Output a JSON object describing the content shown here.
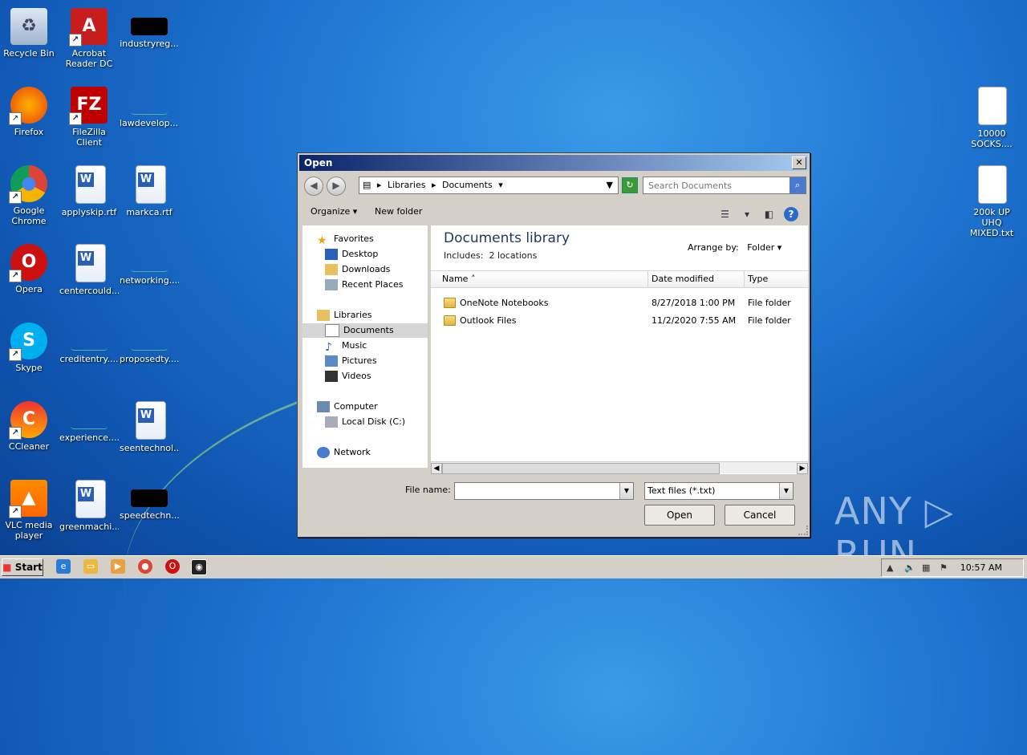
{
  "desktop": {
    "icons_left": [
      {
        "label": "Recycle Bin",
        "icon": "recycle-bin-icon"
      },
      {
        "label": "Acrobat Reader DC",
        "icon": "acrobat-icon"
      },
      {
        "label": "industryreg...",
        "icon": "black-file-icon"
      },
      {
        "label": "Firefox",
        "icon": "firefox-icon"
      },
      {
        "label": "FileZilla Client",
        "icon": "filezilla-icon"
      },
      {
        "label": "lawdevelop....",
        "icon": "blank-file-icon"
      },
      {
        "label": "Google Chrome",
        "icon": "chrome-icon"
      },
      {
        "label": "applyskip.rtf",
        "icon": "word-doc-icon"
      },
      {
        "label": "markca.rtf",
        "icon": "word-doc-icon"
      },
      {
        "label": "Opera",
        "icon": "opera-icon"
      },
      {
        "label": "centercould...",
        "icon": "word-doc-icon"
      },
      {
        "label": "networking....",
        "icon": "blank-file-icon"
      },
      {
        "label": "Skype",
        "icon": "skype-icon"
      },
      {
        "label": "creditentry....",
        "icon": "blank-file-icon"
      },
      {
        "label": "proposedty....",
        "icon": "blank-file-icon"
      },
      {
        "label": "CCleaner",
        "icon": "ccleaner-icon"
      },
      {
        "label": "experience....",
        "icon": "blank-file-icon"
      },
      {
        "label": "seentechnol...",
        "icon": "word-doc-icon"
      },
      {
        "label": "VLC media player",
        "icon": "vlc-icon"
      },
      {
        "label": "greenmachi...",
        "icon": "word-doc-icon"
      },
      {
        "label": "speedtechn...",
        "icon": "black-file-icon"
      }
    ],
    "icons_right": [
      {
        "label": "10000 SOCKS....",
        "icon": "text-file-icon"
      },
      {
        "label": "200k UP UHQ MIXED.txt",
        "icon": "text-file-icon"
      }
    ],
    "watermark": "ANY ▷ RUN"
  },
  "dialog": {
    "title": "Open",
    "close": "✕",
    "breadcrumb": [
      "Libraries",
      "Documents"
    ],
    "search_placeholder": "Search Documents",
    "organize": "Organize",
    "new_folder": "New folder",
    "nav": {
      "favorites": "Favorites",
      "desktop": "Desktop",
      "downloads": "Downloads",
      "recent": "Recent Places",
      "libraries": "Libraries",
      "documents": "Documents",
      "music": "Music",
      "pictures": "Pictures",
      "videos": "Videos",
      "computer": "Computer",
      "local_disk": "Local Disk (C:)",
      "network": "Network"
    },
    "library_title": "Documents library",
    "includes_label": "Includes:",
    "includes_value": "2 locations",
    "arrange_label": "Arrange by:",
    "arrange_value": "Folder",
    "columns": {
      "name": "Name",
      "date": "Date modified",
      "type": "Type"
    },
    "rows": [
      {
        "name": "OneNote Notebooks",
        "date": "8/27/2018 1:00 PM",
        "type": "File folder"
      },
      {
        "name": "Outlook Files",
        "date": "11/2/2020 7:55 AM",
        "type": "File folder"
      }
    ],
    "file_name_label": "File name:",
    "file_name_value": "",
    "file_type": "Text files (*.txt)",
    "open_button": "Open",
    "cancel_button": "Cancel"
  },
  "taskbar": {
    "start": "Start",
    "clock": "10:57 AM"
  }
}
